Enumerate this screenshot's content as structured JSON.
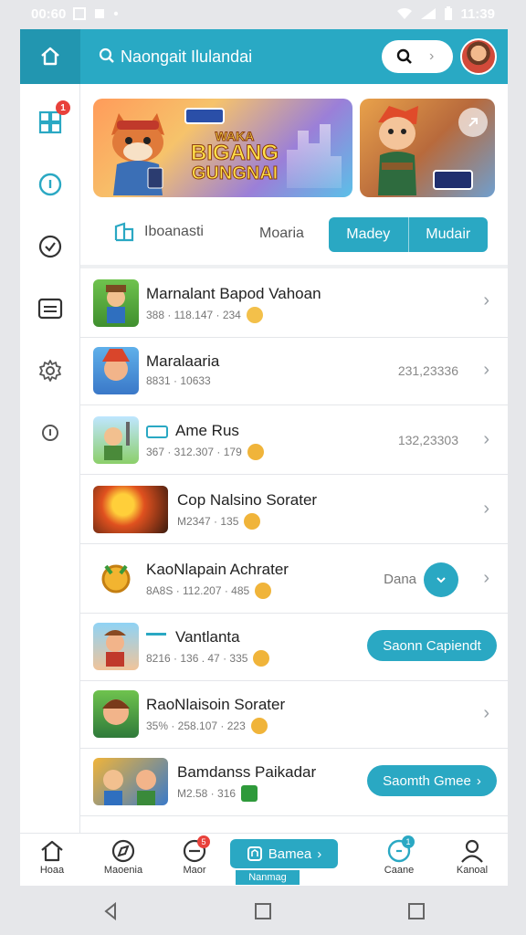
{
  "status_bar": {
    "time_left": "00:60",
    "time_right": "11:39"
  },
  "header": {
    "title": "Naongait Ilulandai"
  },
  "sidebar": {
    "badge": "1"
  },
  "banner": {
    "line1": "WAKA",
    "line2": "BIGANG",
    "line3": "GUNGNAI"
  },
  "filters": {
    "tab1": "Iboanasti",
    "tab2": "Moaria",
    "seg1": "Madey",
    "seg2": "Mudair"
  },
  "list": [
    {
      "name": "Marnalant Bapod Vahoan",
      "meta": "388 · 118.147 · 234",
      "value": "",
      "action": ""
    },
    {
      "name": "Maralaaria",
      "meta": "8831 · 10633",
      "value": "231,23336",
      "action": ""
    },
    {
      "name": "Ame Rus",
      "meta": "367 · 312.307 · 179",
      "value": "132,23303",
      "action": ""
    },
    {
      "name": "Cop Nalsino Sorater",
      "meta": "M2347 · 135",
      "value": "",
      "action": ""
    },
    {
      "name": "KaoNlapain Achrater",
      "meta": "8A8S · 112.207 · 485",
      "value": "Dana",
      "action": ""
    },
    {
      "name": "Vantlanta",
      "meta": "8216 · 136 . 47 · 335",
      "value": "",
      "action": "Saonn Capiendt"
    },
    {
      "name": "RaoNlaisoin Sorater",
      "meta": "35% · 258.107 · 223",
      "value": "",
      "action": ""
    },
    {
      "name": "Bamdanss Paikadar",
      "meta": "M2.58 · 316",
      "value": "",
      "action": "Saomth Gmee"
    }
  ],
  "bottom_nav": {
    "items": [
      "Hoaa",
      "Maoenia",
      "Maor",
      "Namnag",
      "Caane",
      "Kanoal"
    ],
    "active_button": "Bamea",
    "active_sub": "Nanmag",
    "badge1": "5",
    "badge2": "1"
  },
  "colors": {
    "accent": "#29a9c4",
    "badge": "#e8413b"
  }
}
